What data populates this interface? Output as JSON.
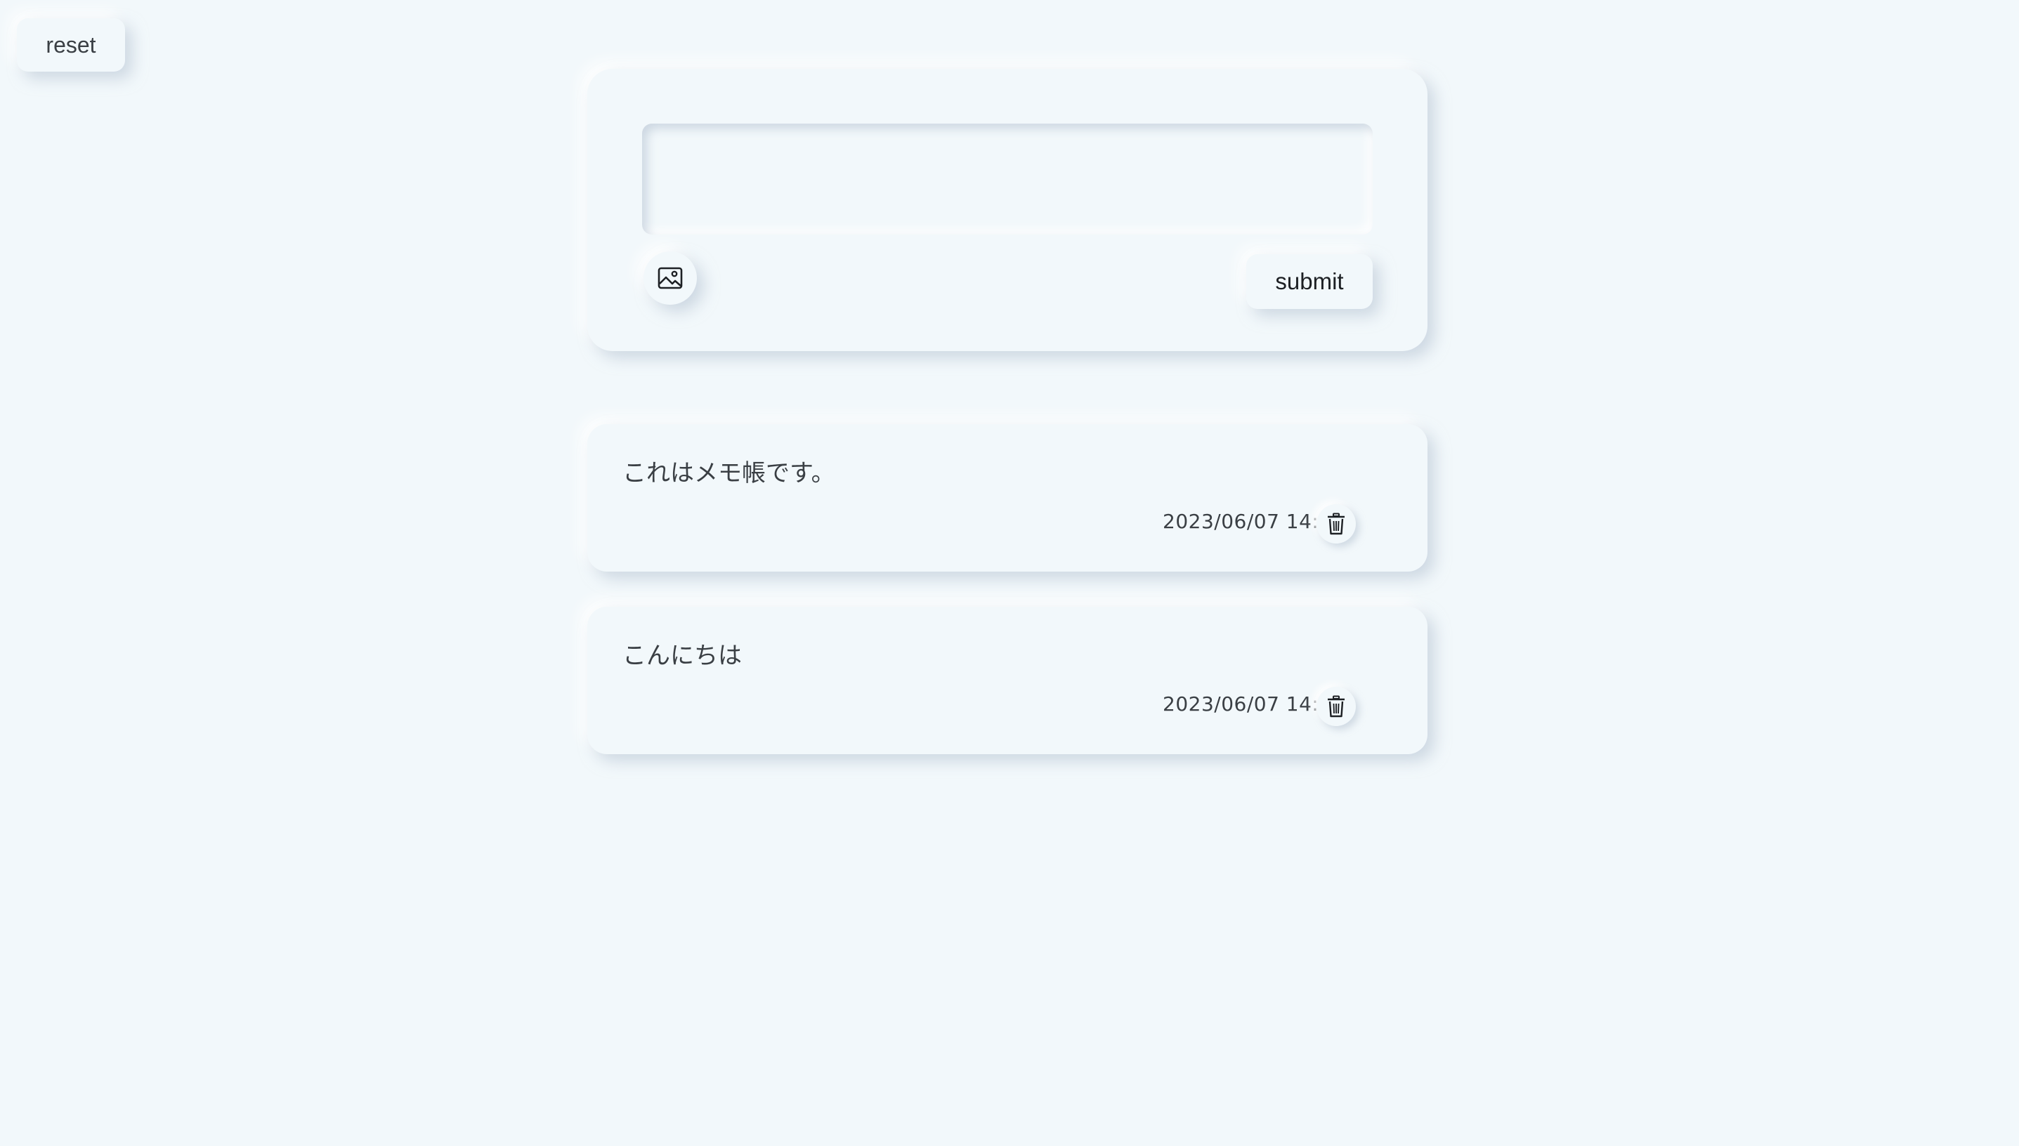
{
  "reset_button": {
    "label": "reset"
  },
  "composer": {
    "input": {
      "value": "",
      "placeholder": ""
    },
    "image_button_icon": "image-icon",
    "submit_label": "submit"
  },
  "memos": [
    {
      "text": "これはメモ帳です。",
      "date": "2023/06/07 14:09",
      "delete_icon": "trash-icon"
    },
    {
      "text": "こんにちは",
      "date": "2023/06/07 14:09",
      "delete_icon": "trash-icon"
    }
  ],
  "colors": {
    "background": "#f2f8fb",
    "text": "#3a3f44"
  }
}
